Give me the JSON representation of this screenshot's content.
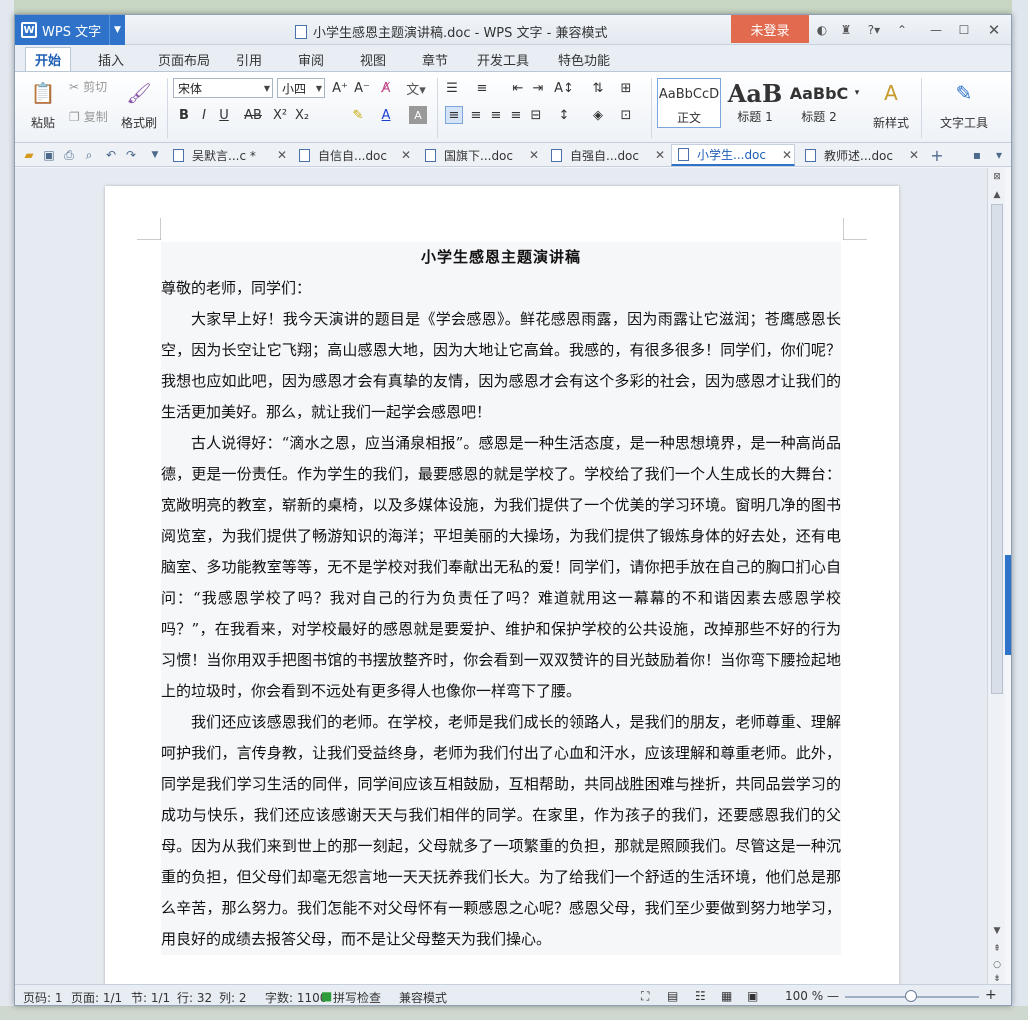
{
  "window": {
    "app_button": "WPS 文字",
    "title": "小学生感恩主题演讲稿.doc - WPS 文字 - 兼容模式",
    "login": "未登录"
  },
  "menu": {
    "tabs": [
      "开始",
      "插入",
      "页面布局",
      "引用",
      "审阅",
      "视图",
      "章节",
      "开发工具",
      "特色功能"
    ],
    "active": "开始"
  },
  "ribbon": {
    "paste": "粘贴",
    "cut": "剪切",
    "copy": "复制",
    "format_painter": "格式刷",
    "font_name": "宋体",
    "font_size": "小四",
    "styles": [
      {
        "sample": "AaBbCcD",
        "label": "正文"
      },
      {
        "sample": "AaB",
        "label": "标题 1"
      },
      {
        "sample": "AaBbC",
        "label": "标题 2"
      }
    ],
    "new_style": "新样式",
    "text_tools": "文字工具"
  },
  "doc_tabs": [
    {
      "label": "吴默言...c *",
      "active": false
    },
    {
      "label": "自信自...doc",
      "active": false
    },
    {
      "label": "国旗下...doc",
      "active": false
    },
    {
      "label": "自强自...doc",
      "active": false
    },
    {
      "label": "小学生...doc",
      "active": true
    },
    {
      "label": "教师述...doc",
      "active": false
    }
  ],
  "document": {
    "title": "小学生感恩主题演讲稿",
    "greeting": "尊敬的老师，同学们：",
    "p1": "大家早上好！我今天演讲的题目是《学会感恩》。鲜花感恩雨露，因为雨露让它滋润；苍鹰感恩长空，因为长空让它飞翔；高山感恩大地，因为大地让它高耸。我感的，有很多很多！同学们，你们呢？我想也应如此吧，因为感恩才会有真挚的友情，因为感恩才会有这个多彩的社会，因为感恩才让我们的生活更加美好。那么，就让我们一起学会感恩吧！",
    "p2": "古人说得好：“滴水之恩，应当涌泉相报”。感恩是一种生活态度，是一种思想境界，是一种高尚品德，更是一份责任。作为学生的我们，最要感恩的就是学校了。学校给了我们一个人生成长的大舞台：宽敞明亮的教室，崭新的桌椅，以及多媒体设施，为我们提供了一个优美的学习环境。窗明几净的图书阅览室，为我们提供了畅游知识的海洋；平坦美丽的大操场，为我们提供了锻炼身体的好去处，还有电脑室、多功能教室等等，无不是学校对我们奉献出无私的爱！同学们，请你把手放在自己的胸口扪心自问：“我感恩学校了吗？我对自己的行为负责任了吗？难道就用这一幕幕的不和谐因素去感恩学校吗？”，在我看来，对学校最好的感恩就是要爱护、维护和保护学校的公共设施，改掉那些不好的行为习惯！当你用双手把图书馆的书摆放整齐时，你会看到一双双赞许的目光鼓励着你！当你弯下腰捡起地上的垃圾时，你会看到不远处有更多得人也像你一样弯下了腰。",
    "p3": "我们还应该感恩我们的老师。在学校，老师是我们成长的领路人，是我们的朋友，老师尊重、理解呵护我们，言传身教，让我们受益终身，老师为我们付出了心血和汗水，应该理解和尊重老师。此外，同学是我们学习生活的同伴，同学间应该互相鼓励，互相帮助，共同战胜困难与挫折，共同品尝学习的成功与快乐，我们还应该感谢天天与我们相伴的同学。在家里，作为孩子的我们，还要感恩我们的父母。因为从我们来到世上的那一刻起，父母就多了一项繁重的负担，那就是照顾我们。尽管这是一种沉重的负担，但父母们却毫无怨言地一天天抚养我们长大。为了给我们一个舒适的生活环境，他们总是那么辛苦，那么努力。我们怎能不对父母怀有一颗感恩之心呢？感恩父母，我们至少要做到努力地学习，用良好的成绩去报答父母，而不是让父母整天为我们操心。"
  },
  "status": {
    "page": "页码: 1",
    "pages": "页面: 1/1",
    "section": "节: 1/1",
    "row": "行: 32",
    "col": "列: 2",
    "words": "字数: 1100",
    "spellcheck": "拼写检查",
    "mode": "兼容模式",
    "zoom": "100 %"
  }
}
